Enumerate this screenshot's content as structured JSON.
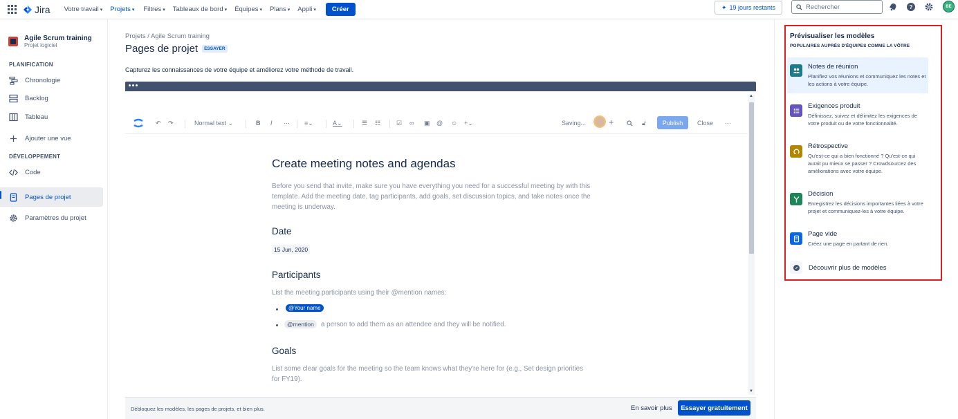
{
  "nav": {
    "logo": "Jira",
    "items": [
      "Votre travail",
      "Projets",
      "Filtres",
      "Tableaux de bord",
      "Équipes",
      "Plans",
      "Appli"
    ],
    "active_index": 1,
    "create": "Créer",
    "trial": "19 jours restants",
    "search_placeholder": "Rechercher",
    "user_initials": "BE"
  },
  "sidebar": {
    "project_name": "Agile Scrum training",
    "project_type": "Projet logiciel",
    "section_planning": "PLANIFICATION",
    "section_dev": "DÉVELOPPEMENT",
    "items": {
      "chronologie": "Chronologie",
      "backlog": "Backlog",
      "tableau": "Tableau",
      "add_view": "Ajouter une vue",
      "code": "Code",
      "pages": "Pages de projet",
      "settings": "Paramètres du projet"
    }
  },
  "main": {
    "breadcrumb": "Projets  /  Agile Scrum training",
    "title": "Pages de projet",
    "badge": "ESSAYER",
    "intro": "Capturez les connaissances de votre équipe et améliorez votre méthode de travail."
  },
  "editor": {
    "toolbar": {
      "text_style": "Normal text",
      "saving": "Saving...",
      "publish": "Publish",
      "close": "Close"
    },
    "doc": {
      "title": "Create meeting notes and agendas",
      "intro": "Before you send that invite, make sure you have everything you need for a successful meeting by with this template. Add the meeting date, tag participants, add goals, set discussion topics, and take notes once the meeting is underway.",
      "date_heading": "Date",
      "date_value": "15 Jun, 2020",
      "participants_heading": "Participants",
      "participants_text": "List the meeting participants using their @mention names:",
      "mention_yours": "@Your name",
      "mention_tag": "@mention",
      "mention_text": "a person to add them as an attendee and they will be notified.",
      "goals_heading": "Goals",
      "goals_text": "List some clear goals for the meeting so the team knows what they're here for (e.g., Set design priorities for FY19)."
    }
  },
  "bottom": {
    "text": "Débloquez les modèles, les pages de projets, et bien plus.",
    "learn_more": "En savoir plus",
    "try_free": "Essayer gratuitement"
  },
  "panel": {
    "title": "Prévisualiser les modèles",
    "subtitle": "POPULAIRES AUPRÈS D'ÉQUIPES COMME LA VÔTRE",
    "templates": [
      {
        "name": "Notes de réunion",
        "desc": "Planifiez vos réunions et communiquez les notes et les actions à votre équipe.",
        "color": "#1d7a8c"
      },
      {
        "name": "Exigences produit",
        "desc": "Définissez, suivez et délimitez les exigences de votre produit ou de votre fonctionnalité.",
        "color": "#6554c0"
      },
      {
        "name": "Rétrospective",
        "desc": "Qu'est-ce qui a bien fonctionné ? Qu'est-ce qui aurait pu mieux se passer ? Crowdsourcez des améliorations avec votre équipe.",
        "color": "#b38600"
      },
      {
        "name": "Décision",
        "desc": "Enregistrez les décisions importantes liées à votre projet et communiquez-les à votre équipe.",
        "color": "#1f845a"
      },
      {
        "name": "Page vide",
        "desc": "Créez une page en partant de rien.",
        "color": "#0c66e4"
      }
    ],
    "discover": "Découvrir plus de modèles"
  }
}
